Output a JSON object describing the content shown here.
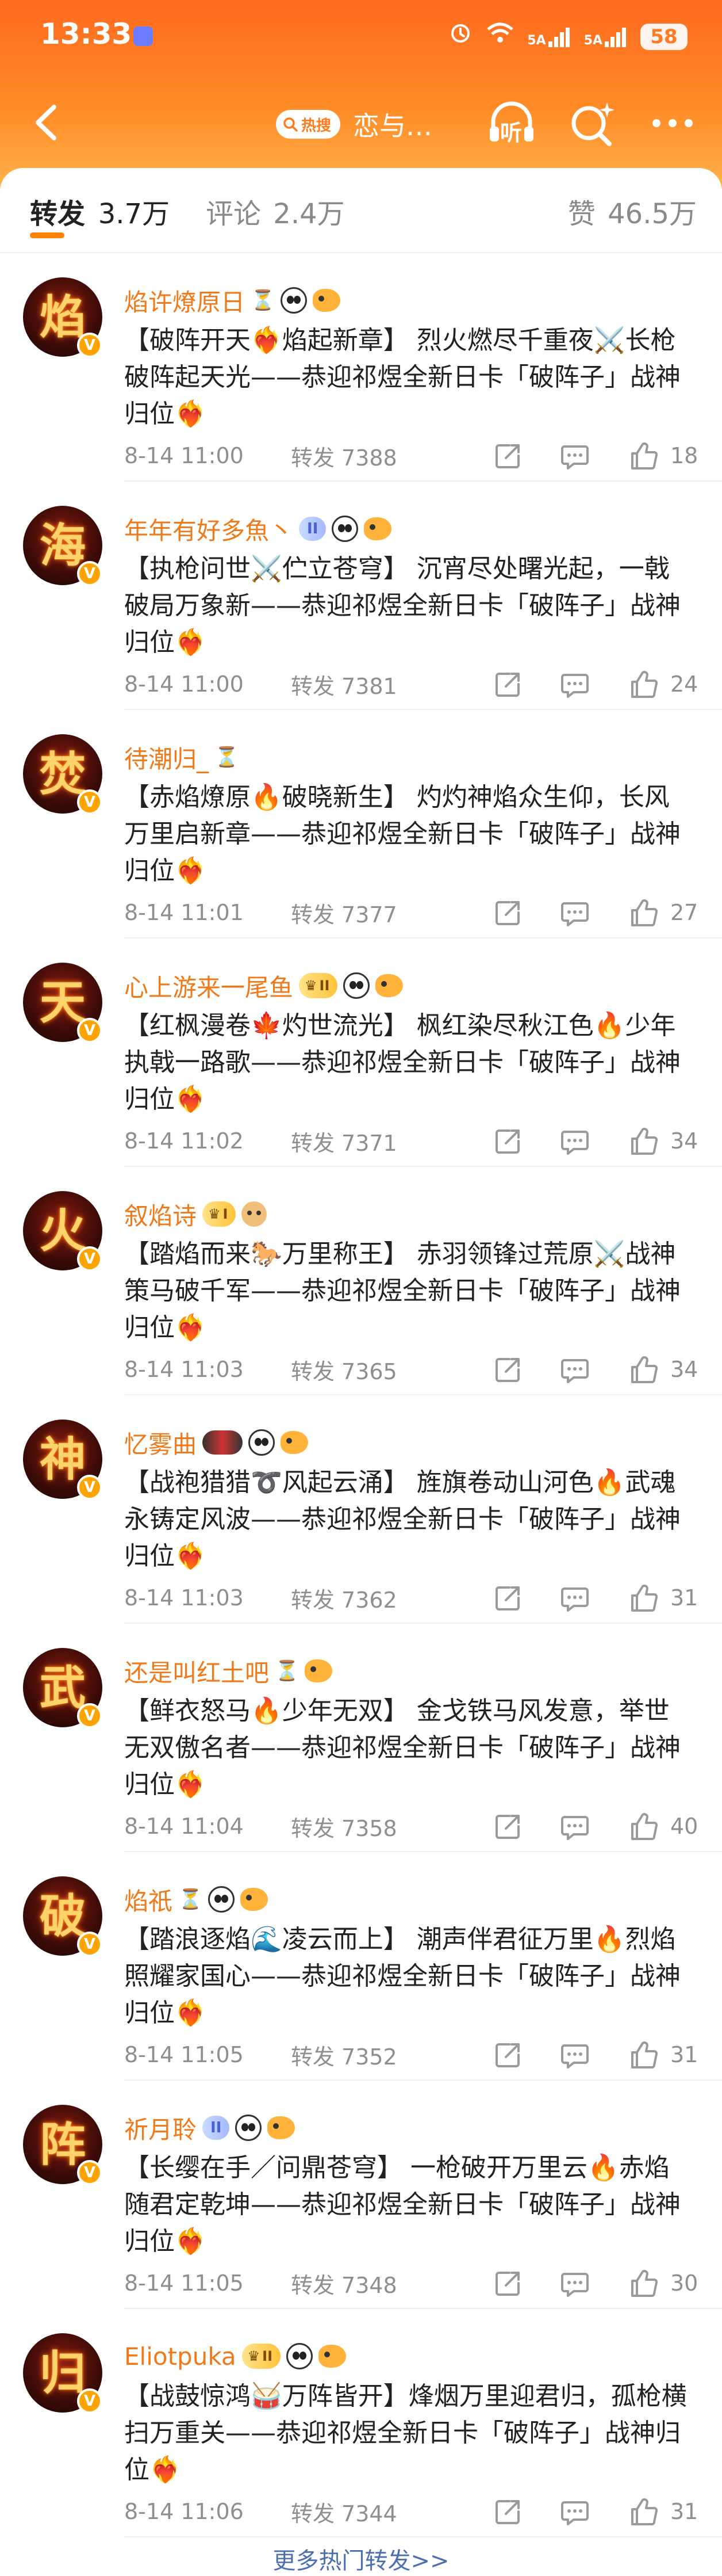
{
  "status_bar": {
    "time": "13:33",
    "network_1": "5A",
    "network_2": "5A",
    "battery": "58"
  },
  "nav": {
    "hot_badge": "热搜",
    "topic_title": "恋与…",
    "listen_label": "听"
  },
  "tabs": {
    "repost_label": "转发",
    "repost_count": "3.7万",
    "comment_label": "评论",
    "comment_count": "2.4万",
    "like_label": "赞",
    "like_count": "46.5万"
  },
  "meta_labels": {
    "repost_prefix": "转发"
  },
  "items": [
    {
      "avatar_char": "焰",
      "username": "焰许燎原日",
      "badges": [
        "hourglass",
        "panda",
        "fish"
      ],
      "text": "【破阵开天❤️‍🔥焰起新章】 烈火燃尽千重夜⚔️长枪破阵起天光——恭迎祁煜全新日卡「破阵子」战神归位❤️‍🔥",
      "time": "8-14 11:00",
      "reposts": "7388",
      "likes": "18"
    },
    {
      "avatar_char": "海",
      "username": "年年有好多魚丶",
      "badges": [
        "lv",
        "panda",
        "fish"
      ],
      "lv_text": "II",
      "text": "【执枪问世⚔️伫立苍穹】 沉宵尽处曙光起，一戟破局万象新——恭迎祁煜全新日卡「破阵子」战神归位❤️‍🔥",
      "time": "8-14 11:00",
      "reposts": "7381",
      "likes": "24"
    },
    {
      "avatar_char": "焚",
      "username": "待潮归_",
      "badges": [
        "hourglass"
      ],
      "text": "【赤焰燎原🔥破晓新生】 灼灼神焰众生仰，长风万里启新章——恭迎祁煜全新日卡「破阵子」战神归位❤️‍🔥",
      "time": "8-14 11:01",
      "reposts": "7377",
      "likes": "27"
    },
    {
      "avatar_char": "天",
      "username": "心上游来一尾鱼",
      "badges": [
        "crown",
        "panda",
        "fish"
      ],
      "crown_text": "II",
      "text": "【红枫漫卷🍁灼世流光】 枫红染尽秋江色🔥少年执戟一路歌——恭迎祁煜全新日卡「破阵子」战神归位❤️‍🔥",
      "time": "8-14 11:02",
      "reposts": "7371",
      "likes": "34"
    },
    {
      "avatar_char": "火",
      "username": "叙焰诗",
      "badges": [
        "crown",
        "cat"
      ],
      "crown_text": "I",
      "text": "【踏焰而来🐎万里称王】 赤羽领锋过荒原⚔️战神策马破千军——恭迎祁煜全新日卡「破阵子」战神归位❤️‍🔥",
      "time": "8-14 11:03",
      "reposts": "7365",
      "likes": "34"
    },
    {
      "avatar_char": "神",
      "username": "忆雾曲",
      "badges": [
        "multi",
        "panda",
        "fish"
      ],
      "text": "【战袍猎猎➰风起云涌】 旌旗卷动山河色🔥武魂永铸定风波——恭迎祁煜全新日卡「破阵子」战神归位❤️‍🔥",
      "time": "8-14 11:03",
      "reposts": "7362",
      "likes": "31"
    },
    {
      "avatar_char": "武",
      "username": "还是叫红土吧",
      "badges": [
        "hourglass",
        "fish"
      ],
      "text": "【鲜衣怒马🔥少年无双】 金戈铁马风发意，举世无双傲名者——恭迎祁煜全新日卡「破阵子」战神归位❤️‍🔥",
      "time": "8-14 11:04",
      "reposts": "7358",
      "likes": "40"
    },
    {
      "avatar_char": "破",
      "username": "焰祇",
      "badges": [
        "hourglass",
        "panda",
        "fish"
      ],
      "text": "【踏浪逐焰🌊凌云而上】 潮声伴君征万里🔥烈焰照耀家国心——恭迎祁煜全新日卡「破阵子」战神归位❤️‍🔥",
      "time": "8-14 11:05",
      "reposts": "7352",
      "likes": "31"
    },
    {
      "avatar_char": "阵",
      "username": "祈月聆",
      "badges": [
        "lv",
        "panda",
        "fish"
      ],
      "lv_text": "II",
      "text": "【长缨在手／问鼎苍穹】 一枪破开万里云🔥赤焰随君定乾坤——恭迎祁煜全新日卡「破阵子」战神归位❤️‍🔥",
      "time": "8-14 11:05",
      "reposts": "7348",
      "likes": "30"
    },
    {
      "avatar_char": "归",
      "username": "Eliotpuka",
      "badges": [
        "crown",
        "panda",
        "fish"
      ],
      "crown_text": "II",
      "text": "【战鼓惊鸿🥁万阵皆开】烽烟万里迎君归，孤枪横扫万重关——恭迎祁煜全新日卡「破阵子」战神归位❤️‍🔥",
      "time": "8-14 11:06",
      "reposts": "7344",
      "likes": "31"
    }
  ],
  "more_hot": "更多热门转发>>",
  "colors": {
    "brand_orange": "#ff8200",
    "username": "#f07a1a",
    "link_blue": "#4c6fb0"
  },
  "icons": {
    "back": "back-arrow-icon",
    "listen": "headphones-icon",
    "search": "search-sparkle-icon",
    "more": "more-dots-icon",
    "share": "share-icon",
    "comment": "comment-icon",
    "like": "thumbs-up-icon"
  }
}
